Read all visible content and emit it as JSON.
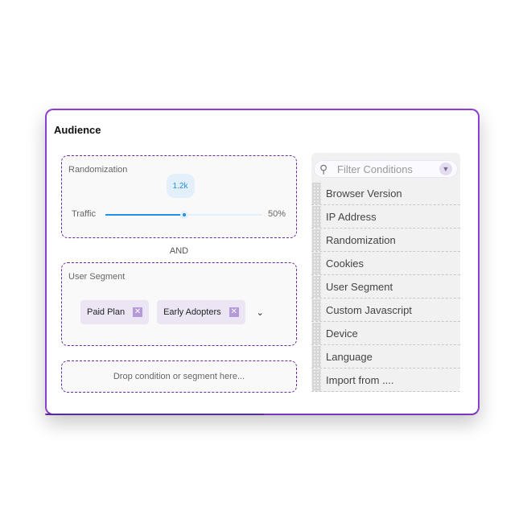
{
  "title": "Audience",
  "randomization": {
    "label": "Randomization",
    "traffic_label": "Traffic",
    "tooltip": "1.2k",
    "percent_label": "50%",
    "value_percent": 50
  },
  "connector": "AND",
  "user_segment": {
    "label": "User Segment",
    "chips": [
      "Paid Plan",
      "Early Adopters"
    ],
    "remove_icon": "✕",
    "chevron": "⌄"
  },
  "drop_zone": "Drop condition or segment here...",
  "conditions": {
    "placeholder": "Filter Conditions",
    "items": [
      "Browser Version",
      "IP Address",
      "Randomization",
      "Cookies",
      "User Segment",
      "Custom Javascript",
      "Device",
      "Language",
      "Import from ...."
    ]
  },
  "colors": {
    "accent": "#2190e8",
    "border": "#8a3fd0"
  }
}
